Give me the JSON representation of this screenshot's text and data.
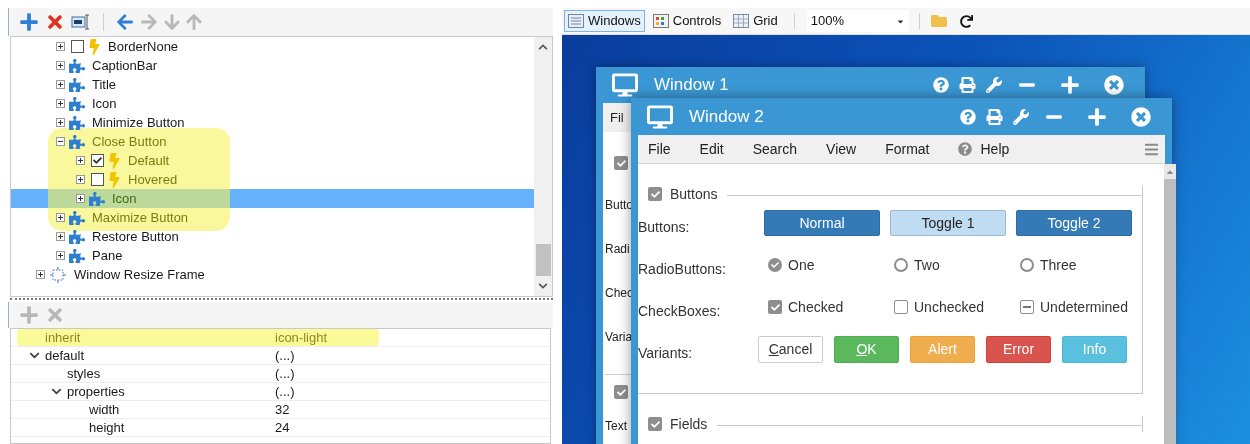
{
  "editor": {
    "toolbar": [
      {
        "kind": "add",
        "disabled": false
      },
      {
        "kind": "delete",
        "disabled": false
      },
      {
        "kind": "rename",
        "disabled": false
      },
      {
        "kind": "back",
        "disabled": false
      },
      {
        "kind": "forward",
        "disabled": true
      },
      {
        "kind": "down",
        "disabled": true
      },
      {
        "kind": "up",
        "disabled": true
      }
    ],
    "tree": [
      {
        "children": [
          {
            "label": "BorderNone",
            "kind": "state",
            "checked": false,
            "expanded": false,
            "selected": false,
            "highlighted": false
          },
          {
            "label": "CaptionBar",
            "kind": "part",
            "expanded": false,
            "selected": false,
            "highlighted": false
          },
          {
            "label": "Title",
            "kind": "part",
            "expanded": false,
            "selected": false,
            "highlighted": false
          },
          {
            "label": "Icon",
            "kind": "part",
            "expanded": false,
            "selected": false,
            "highlighted": false
          },
          {
            "label": "Minimize Button",
            "kind": "part",
            "expanded": false,
            "selected": false,
            "highlighted": false
          },
          {
            "label": "Close Button",
            "kind": "part",
            "expanded": true,
            "selected": false,
            "highlighted": true,
            "children": [
              {
                "label": "Default",
                "kind": "state",
                "checked": true,
                "expanded": false,
                "selected": false,
                "highlighted": true
              },
              {
                "label": "Hovered",
                "kind": "state",
                "checked": false,
                "expanded": false,
                "selected": false,
                "highlighted": true
              },
              {
                "label": "Icon",
                "kind": "part",
                "expanded": false,
                "selected": true,
                "highlighted": true
              }
            ]
          },
          {
            "label": "Maximize Button",
            "kind": "part",
            "expanded": false,
            "selected": false,
            "highlighted": true
          },
          {
            "label": "Restore Button",
            "kind": "part",
            "expanded": false,
            "selected": false,
            "highlighted": false
          },
          {
            "label": "Pane",
            "kind": "part",
            "expanded": false,
            "selected": false,
            "highlighted": false
          }
        ]
      },
      {
        "label": "Window Resize Frame",
        "kind": "frame",
        "expanded": false,
        "selected": false,
        "highlighted": false
      }
    ],
    "properties_toolbar": [
      {
        "kind": "add",
        "disabled": true
      },
      {
        "kind": "delete",
        "disabled": true
      }
    ],
    "properties": [
      {
        "name": "inherit",
        "value": "icon-light",
        "highlighted": true
      },
      {
        "name": "default",
        "value": "(...)",
        "highlighted": false,
        "expanded": true,
        "children": [
          {
            "name": "styles",
            "value": "(...)",
            "highlighted": false
          },
          {
            "name": "properties",
            "value": "(...)",
            "highlighted": false,
            "expanded": true,
            "children": [
              {
                "name": "width",
                "value": "32",
                "highlighted": false
              },
              {
                "name": "height",
                "value": "24",
                "highlighted": false
              }
            ]
          }
        ]
      }
    ]
  },
  "preview": {
    "view_tabs": [
      {
        "label": "Windows",
        "kind": "windows",
        "selected": true
      },
      {
        "label": "Controls",
        "kind": "controls",
        "selected": false
      },
      {
        "label": "Grid",
        "kind": "grid",
        "selected": false
      }
    ],
    "zoom": "100%",
    "window_1": {
      "title": "Window 1",
      "menu_label": "Fil",
      "group_checked": true,
      "row_labels": [
        "Butto",
        "Radi",
        "Chec",
        "Varia"
      ],
      "second_group_checked": true,
      "second_group_labels": [
        "Text"
      ]
    },
    "window_2": {
      "title": "Window 2",
      "menu": [
        {
          "label": "File",
          "kind": "plain"
        },
        {
          "label": "Edit",
          "kind": "plain"
        },
        {
          "label": "Search",
          "kind": "plain"
        },
        {
          "label": "View",
          "kind": "plain"
        },
        {
          "label": "Format",
          "kind": "plain"
        },
        {
          "label": "Help",
          "kind": "help"
        }
      ],
      "groups": [
        {
          "title": "Buttons",
          "checked": true,
          "rows": [
            {
              "label": "Buttons:",
              "kind": "buttons",
              "items": [
                {
                  "label": "Normal",
                  "selected": false
                },
                {
                  "label": "Toggle 1",
                  "selected": true
                },
                {
                  "label": "Toggle 2",
                  "selected": false
                }
              ]
            },
            {
              "label": "RadioButtons:",
              "kind": "radios",
              "items": [
                {
                  "label": "One",
                  "selected": true
                },
                {
                  "label": "Two",
                  "selected": false
                },
                {
                  "label": "Three",
                  "selected": false
                }
              ]
            },
            {
              "label": "CheckBoxes:",
              "kind": "checkboxes",
              "items": [
                {
                  "label": "Checked",
                  "kind": "box",
                  "checked": true
                },
                {
                  "label": "Unchecked",
                  "kind": "box",
                  "checked": false
                },
                {
                  "label": "Undetermined",
                  "kind": "tristate",
                  "indeterminate": true
                }
              ]
            },
            {
              "label": "Variants:",
              "kind": "variants",
              "items": [
                {
                  "label": "Cancel",
                  "kind": "default",
                  "mnemonic": true
                },
                {
                  "label": "OK",
                  "kind": "success",
                  "mnemonic": true
                },
                {
                  "label": "Alert",
                  "kind": "warning",
                  "mnemonic": false
                },
                {
                  "label": "Error",
                  "kind": "danger",
                  "mnemonic": false
                },
                {
                  "label": "Info",
                  "kind": "info",
                  "mnemonic": false
                }
              ]
            }
          ]
        },
        {
          "title": "Fields",
          "checked": true
        }
      ]
    }
  }
}
